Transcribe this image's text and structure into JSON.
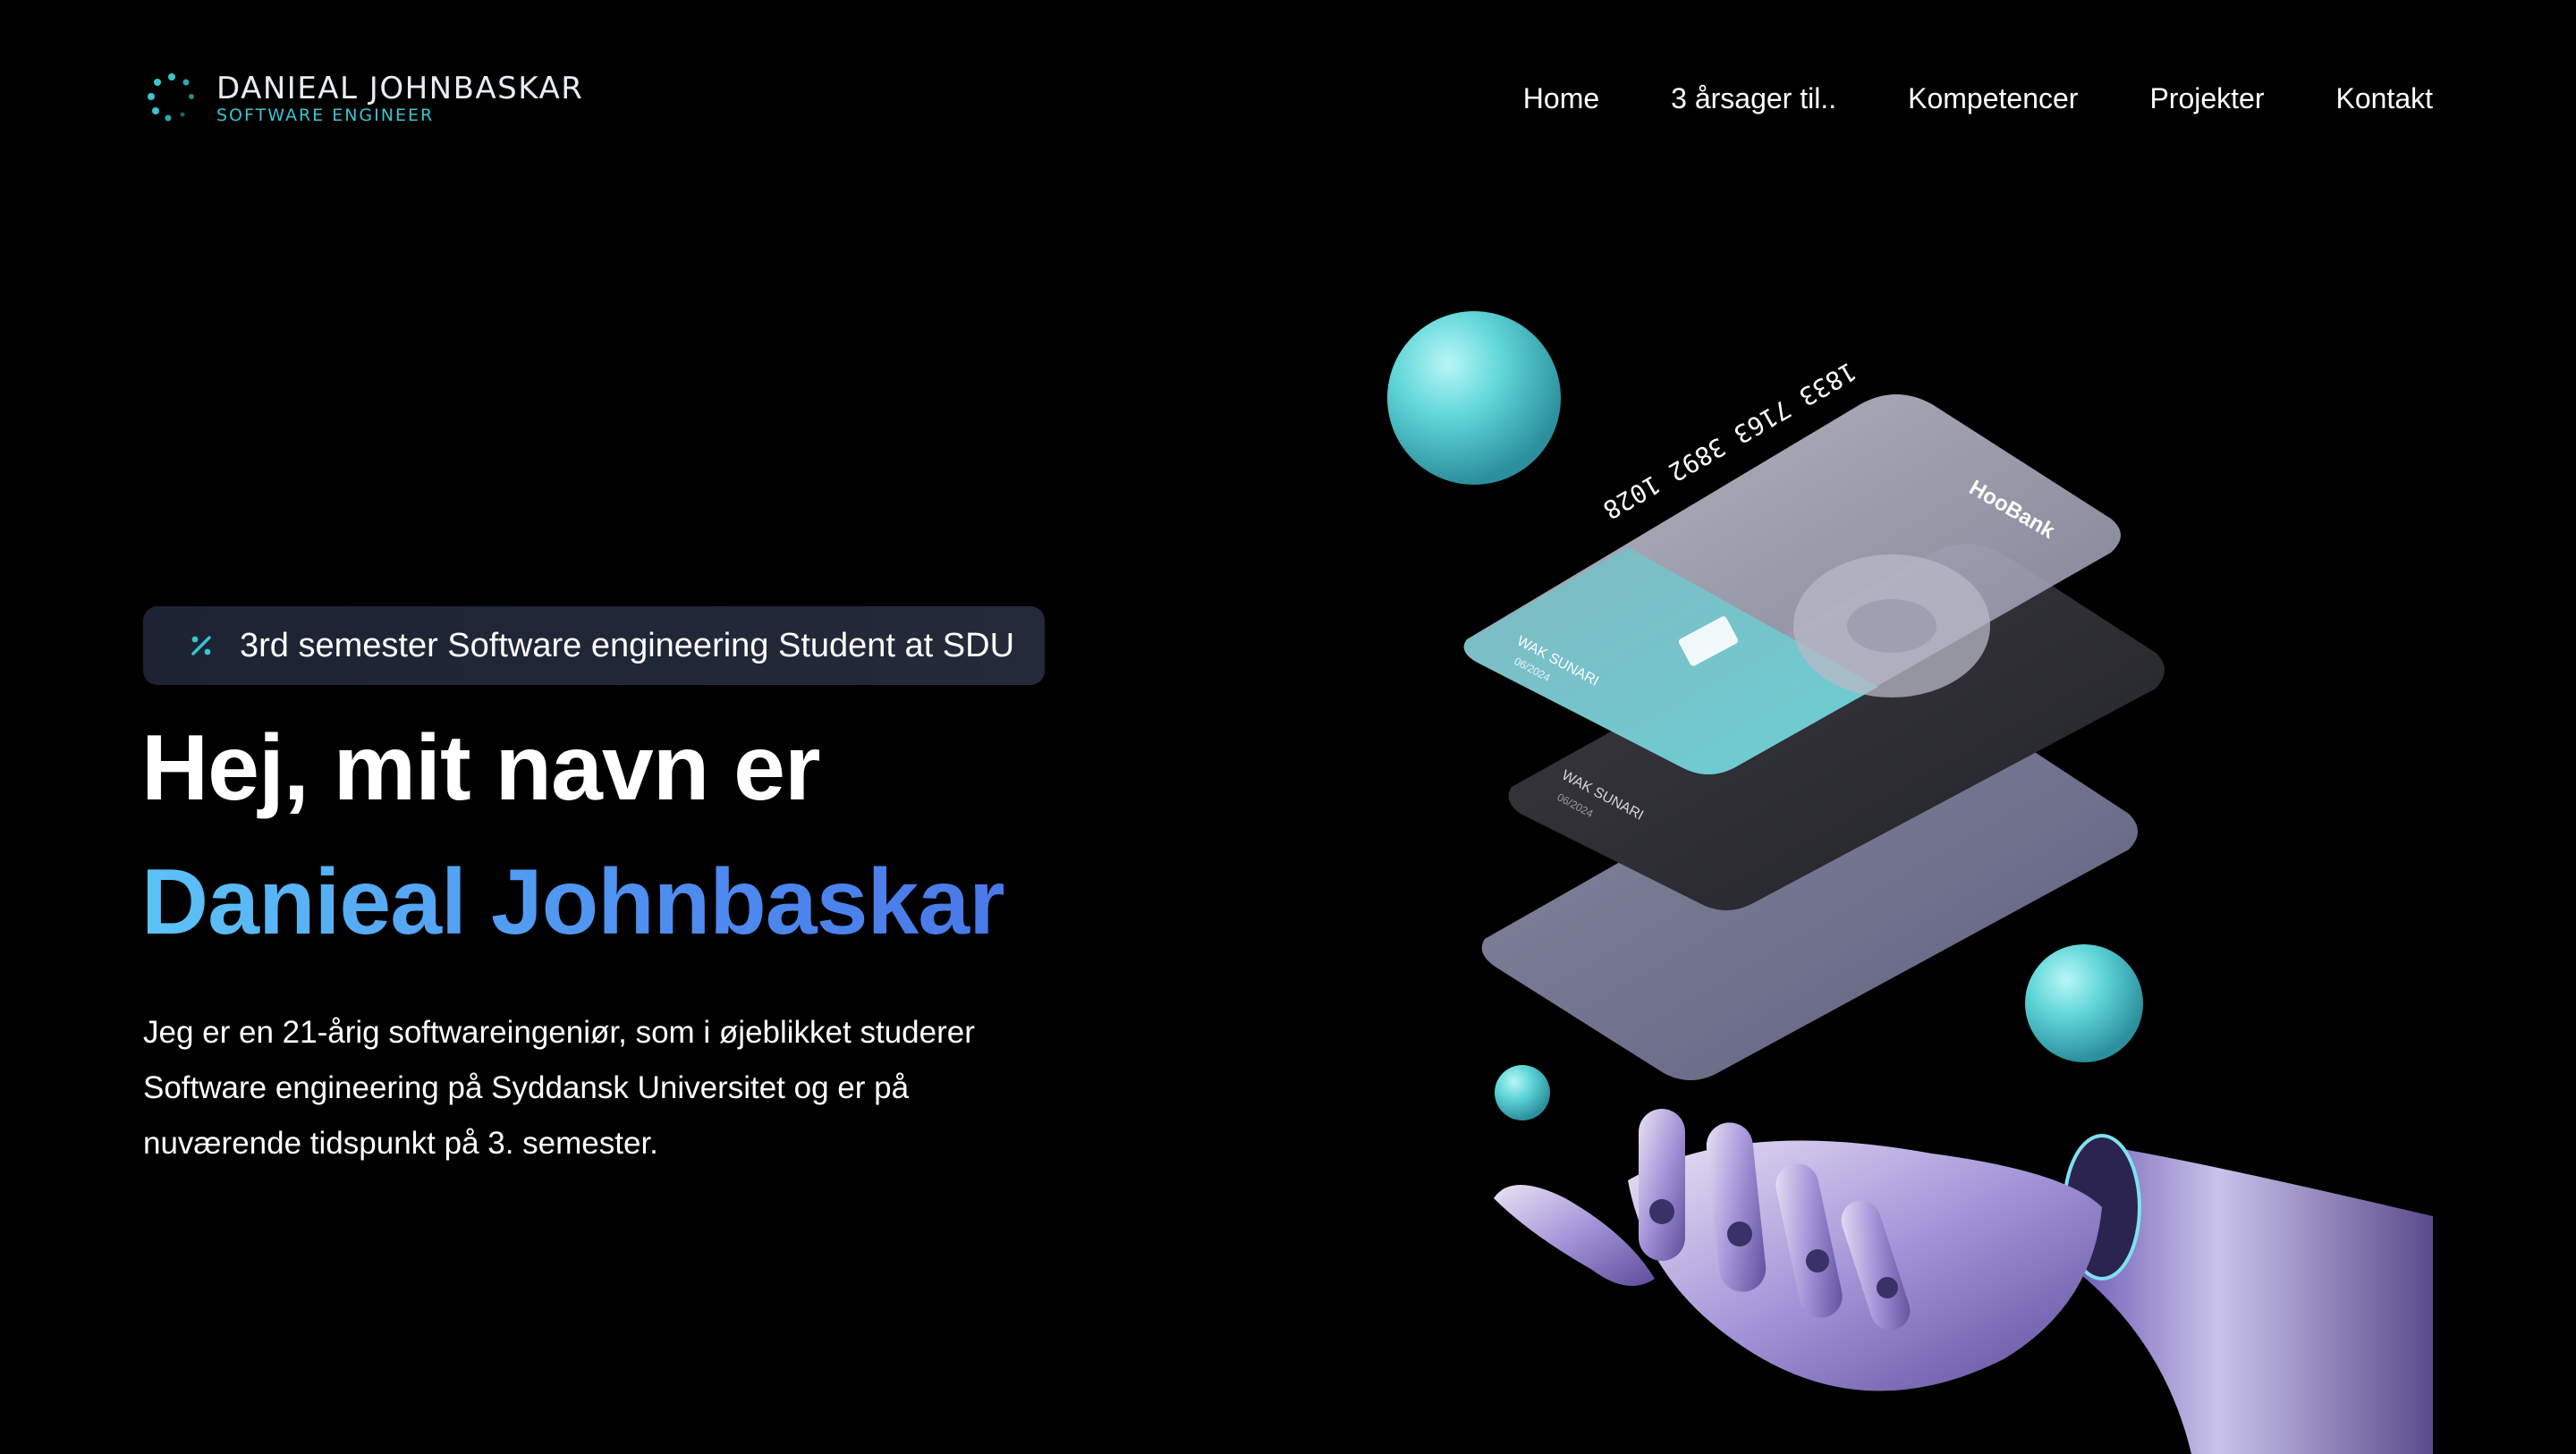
{
  "logo": {
    "name": "DANIEAL JOHNBASKAR",
    "subtitle": "SOFTWARE ENGINEER",
    "accent": "#37c6cf"
  },
  "nav": {
    "items": [
      {
        "label": "Home"
      },
      {
        "label": "3 årsager til.."
      },
      {
        "label": "Kompetencer"
      },
      {
        "label": "Projekter"
      },
      {
        "label": "Kontakt"
      }
    ]
  },
  "hero": {
    "badge_icon": "percent-icon",
    "badge_text": "3rd semester Software engineering Student at SDU",
    "title_line1": "Hej, mit navn er",
    "title_line2": "Danieal Johnbaskar",
    "description": "Jeg er en 21-årig softwareingeniør, som i øjeblikket studerer Software engineering på Syddansk Universitet og er på nuværende tidspunkt på 3. semester.",
    "gradient_colors": [
      "#5cc3f6",
      "#4a78e8"
    ]
  },
  "art": {
    "card_number": "1833 7163 3892 1028",
    "card_brand": "HooBank",
    "card_holder": "WAK SUNARI",
    "card_expiry": "06/2024"
  }
}
